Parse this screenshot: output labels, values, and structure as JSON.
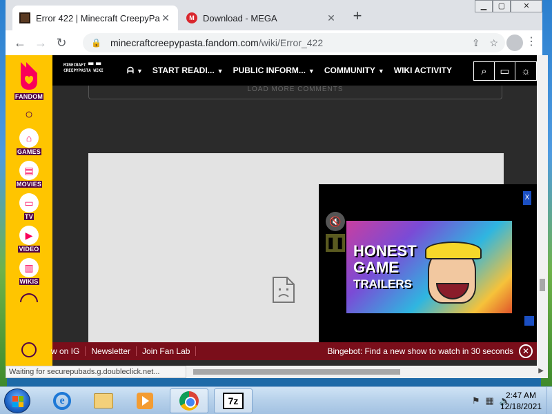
{
  "browser": {
    "tabs": [
      {
        "title": "Error 422 | Minecraft CreepyPasta",
        "active": true,
        "icon": "minecraft-favicon"
      },
      {
        "title": "Download - MEGA",
        "active": false,
        "icon": "mega-favicon"
      }
    ],
    "new_tab_glyph": "+",
    "url_host": "minecraftcreepypasta.fandom.com",
    "url_path": "/wiki/Error_422"
  },
  "fandom_rail": {
    "brand": "FANDOM",
    "items": [
      {
        "label": "GAMES",
        "icon": "gamepad-icon",
        "glyph": "⌂"
      },
      {
        "label": "MOVIES",
        "icon": "clapper-icon",
        "glyph": "▤"
      },
      {
        "label": "TV",
        "icon": "tv-icon",
        "glyph": "▭"
      },
      {
        "label": "VIDEO",
        "icon": "play-icon",
        "glyph": "▶"
      },
      {
        "label": "WIKIS",
        "icon": "book-icon",
        "glyph": "▥"
      }
    ]
  },
  "wiki_nav": {
    "logo_line1": "MINECRAFT ▀▀ ▀▀",
    "logo_line2": "CREEPYPASTA WIKI",
    "items": [
      {
        "label": "START READI...",
        "dropdown": true
      },
      {
        "label": "PUBLIC INFORM...",
        "dropdown": true
      },
      {
        "label": "COMMUNITY",
        "dropdown": true
      },
      {
        "label": "WIKI ACTIVITY",
        "dropdown": false
      }
    ]
  },
  "comments_button": "LOAD MORE COMMENTS",
  "video_popup": {
    "close_label": "X",
    "title_line1": "HONEST",
    "title_line2": "GAME",
    "title_line3": "TRAILERS"
  },
  "bottom_bar": {
    "items": [
      "w on IG",
      "Newsletter",
      "Join Fan Lab"
    ],
    "promo": "Bingebot: Find a new show to watch in 30 seconds"
  },
  "status_text": "Waiting for securepubads.g.doubleclick.net...",
  "taskbar": {
    "time": "2:47 AM",
    "date": "12/18/2021",
    "apps": [
      "internet-explorer",
      "windows-explorer",
      "media-player",
      "google-chrome",
      "7-zip"
    ]
  },
  "colors": {
    "fandom_yellow": "#ffc500",
    "fandom_purple": "#520044",
    "bottom_bar": "#7a0e1a"
  }
}
